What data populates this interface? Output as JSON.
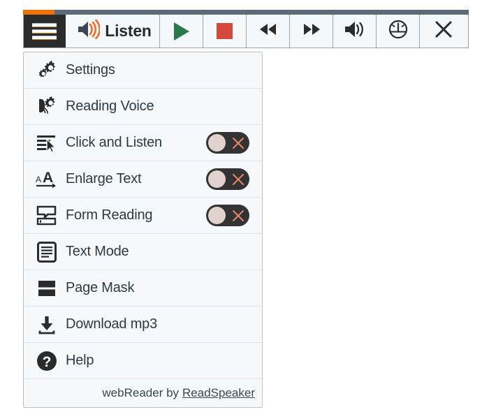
{
  "toolbar": {
    "progress_percent": 7,
    "buttons": [
      {
        "name": "menu-button",
        "icon": "hamburger-icon",
        "label": "Menu"
      },
      {
        "name": "listen-button",
        "icon": "speaker-icon",
        "label": "Listen"
      },
      {
        "name": "play-button",
        "icon": "play-icon",
        "label": "Play"
      },
      {
        "name": "stop-button",
        "icon": "stop-icon",
        "label": "Stop"
      },
      {
        "name": "rewind-button",
        "icon": "rewind-icon",
        "label": "Rewind"
      },
      {
        "name": "forward-button",
        "icon": "forward-icon",
        "label": "Forward"
      },
      {
        "name": "volume-button",
        "icon": "volume-icon",
        "label": "Volume"
      },
      {
        "name": "speed-button",
        "icon": "speed-gauge-icon",
        "label": "Reading speed"
      },
      {
        "name": "close-button",
        "icon": "close-icon",
        "label": "Close"
      }
    ],
    "listen_label": "Listen"
  },
  "menu": {
    "items": [
      {
        "label": "Settings",
        "icon": "gears-icon",
        "has_toggle": false
      },
      {
        "label": "Reading Voice",
        "icon": "voice-gear-icon",
        "has_toggle": false
      },
      {
        "label": "Click and Listen",
        "icon": "text-cursor-icon",
        "has_toggle": true,
        "toggle_state": "off"
      },
      {
        "label": "Enlarge Text",
        "icon": "enlarge-text-icon",
        "has_toggle": true,
        "toggle_state": "off"
      },
      {
        "label": "Form Reading",
        "icon": "form-reading-icon",
        "has_toggle": true,
        "toggle_state": "off"
      },
      {
        "label": "Text Mode",
        "icon": "document-icon",
        "has_toggle": false
      },
      {
        "label": "Page Mask",
        "icon": "page-mask-icon",
        "has_toggle": false
      },
      {
        "label": "Download mp3",
        "icon": "download-icon",
        "has_toggle": false
      },
      {
        "label": "Help",
        "icon": "question-mark-icon",
        "has_toggle": false
      }
    ],
    "footer": {
      "text": "webReader by",
      "link": "ReadSpeaker"
    }
  },
  "colors": {
    "accent_orange": "#ef7100",
    "progress_track": "#5d6b78",
    "play_green": "#2a7a4c",
    "stop_red": "#d4483e",
    "toggle_track": "#333333",
    "toggle_knob": "#e2d2ce",
    "toggle_x": "#e8866a",
    "icon_dark": "#2d3a45",
    "menu_bg": "#f6f9fb"
  }
}
